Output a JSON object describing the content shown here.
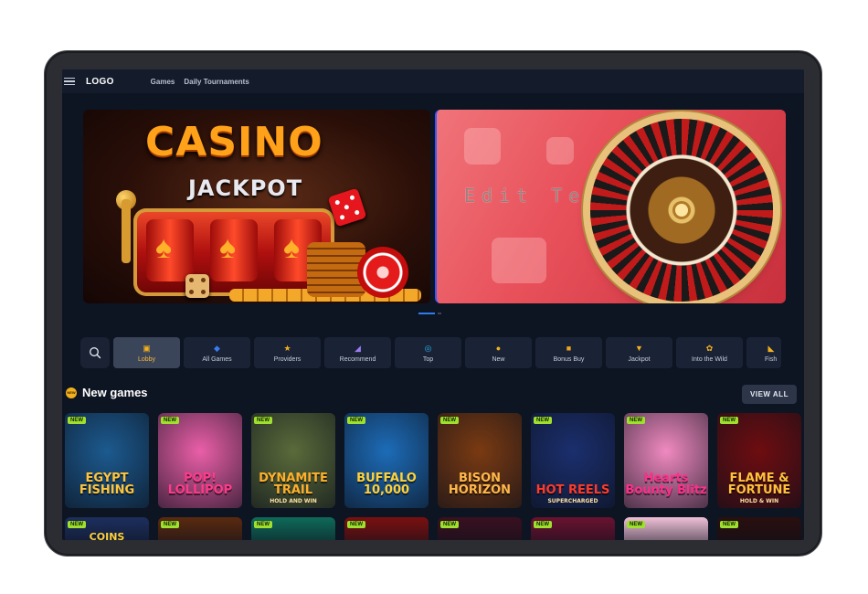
{
  "header": {
    "logo": "LOGO",
    "nav": [
      "Games",
      "Daily Tournaments"
    ]
  },
  "banners": {
    "casino_title": "CASINO",
    "casino_subtitle": "JACKPOT",
    "placeholder_text": "Edit Text"
  },
  "categories": [
    {
      "label": "Lobby",
      "icon": "lobby-icon",
      "color": "#f2b01e",
      "active": true
    },
    {
      "label": "All Games",
      "icon": "gamepad-icon",
      "color": "#3a7df0"
    },
    {
      "label": "Providers",
      "icon": "providers-icon",
      "color": "#f2b01e"
    },
    {
      "label": "Recommend",
      "icon": "megaphone-icon",
      "color": "#9a7cf0"
    },
    {
      "label": "Top",
      "icon": "target-icon",
      "color": "#2fb3f0"
    },
    {
      "label": "New",
      "icon": "new-badge-icon",
      "color": "#f2b01e"
    },
    {
      "label": "Bonus Buy",
      "icon": "gift-icon",
      "color": "#f2a41e"
    },
    {
      "label": "Jackpot",
      "icon": "trophy-icon",
      "color": "#f2b01e"
    },
    {
      "label": "Into the Wild",
      "icon": "paw-icon",
      "color": "#f2b01e"
    },
    {
      "label": "Fish",
      "icon": "fish-icon",
      "color": "#f2b01e"
    }
  ],
  "new_games": {
    "title": "New games",
    "badge": "NEW",
    "view_all": "VIEW ALL",
    "games": [
      {
        "title": "EGYPT FISHING",
        "subtitle": "",
        "bg": "#1c5a8f",
        "fg": "#ffc53a"
      },
      {
        "title": "POP! LOLLIPOP",
        "subtitle": "",
        "bg": "#ea5fa8",
        "fg": "#ff3a8a"
      },
      {
        "title": "DYNAMITE TRAIL",
        "subtitle": "HOLD AND WIN",
        "bg": "#5a6b3a",
        "fg": "#ffb02a"
      },
      {
        "title": "BUFFALO 10,000",
        "subtitle": "",
        "bg": "#1d6cb8",
        "fg": "#ffd23a"
      },
      {
        "title": "BISON HORIZON",
        "subtitle": "",
        "bg": "#7a3a12",
        "fg": "#ffb84a"
      },
      {
        "title": "HOT REELS",
        "subtitle": "SUPERCHARGED",
        "bg": "#1b2f6e",
        "fg": "#ff3a2a"
      },
      {
        "title": "Hearts Bounty Blitz",
        "subtitle": "",
        "bg": "#f08ac0",
        "fg": "#ff2e8a"
      },
      {
        "title": "FLAME & FORTUNE",
        "subtitle": "HOLD & WIN",
        "bg": "#6e0d10",
        "fg": "#ffc23a"
      }
    ],
    "row2": [
      {
        "title": "COINS",
        "bg": "#1d2f5e"
      },
      {
        "title": "",
        "bg": "#5a2a10"
      },
      {
        "title": "",
        "bg": "#0f6a5a"
      },
      {
        "title": "",
        "bg": "#7a1010"
      },
      {
        "title": "",
        "bg": "#3a1020"
      },
      {
        "title": "",
        "bg": "#6a1230"
      },
      {
        "title": "",
        "bg": "#f0c0d8"
      },
      {
        "title": "",
        "bg": "#2a0f0f"
      }
    ]
  }
}
